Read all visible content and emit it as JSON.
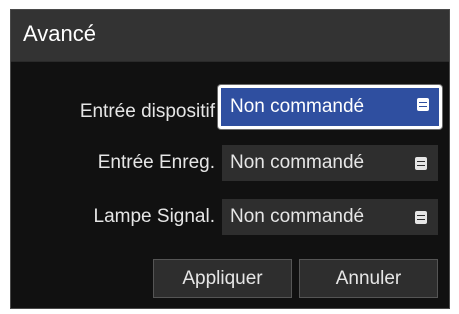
{
  "dialog": {
    "title": "Avancé"
  },
  "settings": [
    {
      "label": "Entrée dispositif",
      "value": "Non commandé",
      "icon": "menu-icon"
    },
    {
      "label": "Entrée Enreg.",
      "value": "Non commandé",
      "icon": "menu-icon"
    },
    {
      "label": "Lampe Signal.",
      "value": "Non commandé",
      "icon": "menu-icon"
    }
  ],
  "buttons": {
    "apply_label": "Appliquer",
    "cancel_label": "Annuler"
  },
  "colors": {
    "dialog_background": "#111111",
    "titlebar_background": "#333333",
    "field_background": "#2e2e2e",
    "focus_accent": "#2f4fa0",
    "text": "#e6e6e6"
  }
}
